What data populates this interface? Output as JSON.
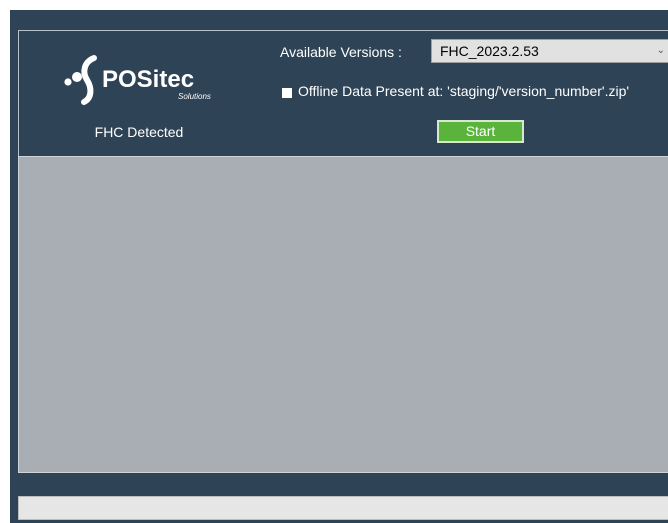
{
  "header": {
    "logo": {
      "brand": "POSitec",
      "tagline": "Solutions",
      "icon": "positec-logo-icon"
    },
    "status_text": "FHC Detected",
    "versions_label": "Available Versions :",
    "versions_selected": "FHC_2023.2.53",
    "versions_dropdown_icon": "chevron-down-icon",
    "offline_checkbox_checked": false,
    "offline_label": "Offline Data Present at: 'staging/'version_number'.zip'",
    "start_label": "Start"
  },
  "log": {
    "lines": []
  },
  "progress": {
    "value": 0
  },
  "colors": {
    "window_bg": "#2e4356",
    "start_button": "#5ab43c",
    "log_bg": "#a9adb4",
    "progress_track": "#e6e6e6"
  }
}
